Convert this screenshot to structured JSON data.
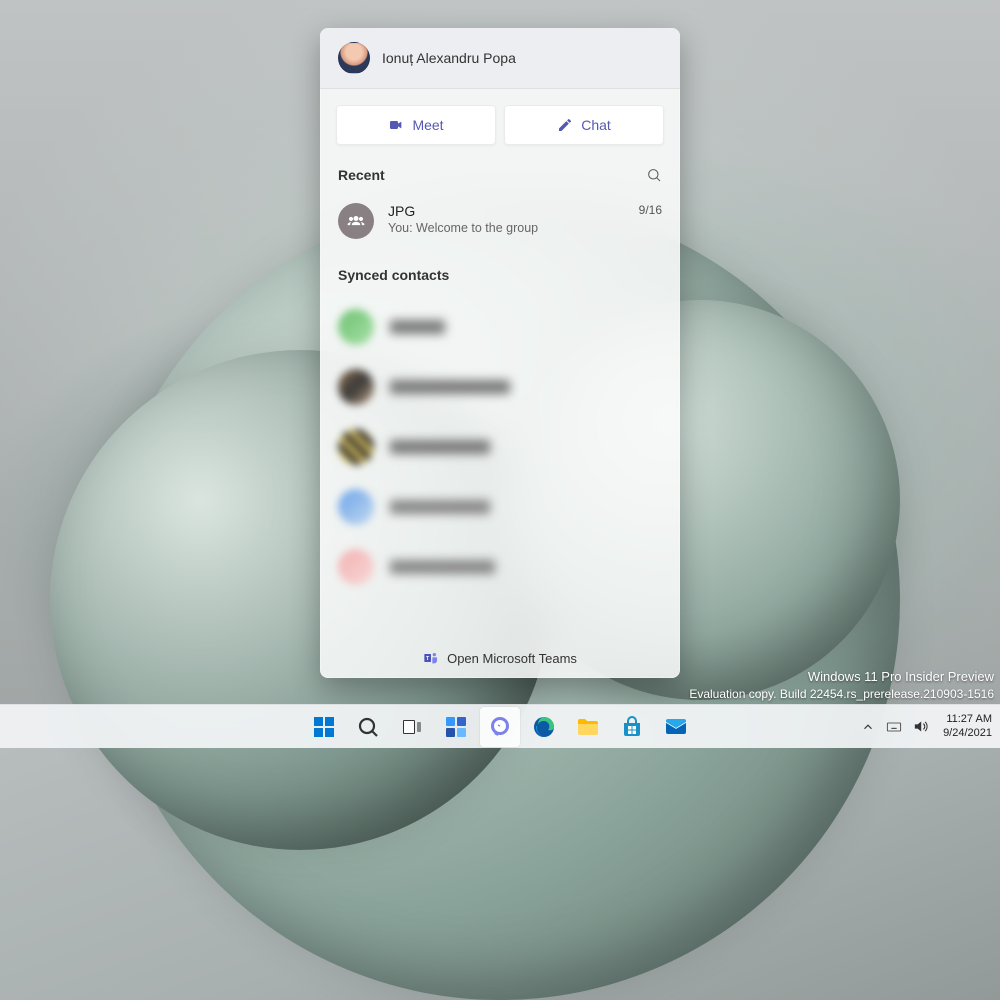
{
  "user": {
    "name": "Ionuț Alexandru Popa"
  },
  "actions": {
    "meet": "Meet",
    "chat": "Chat"
  },
  "recent": {
    "heading": "Recent",
    "item": {
      "title": "JPG",
      "subtitle": "You: Welcome to the group",
      "date": "9/16"
    }
  },
  "contacts_heading": "Synced contacts",
  "footer": {
    "text": "Open Microsoft Teams"
  },
  "watermark": {
    "line1": "Windows 11 Pro Insider Preview",
    "line2": "Evaluation copy. Build 22454.rs_prerelease.210903-1516"
  },
  "clock": {
    "time": "11:27 AM",
    "date": "9/24/2021"
  }
}
